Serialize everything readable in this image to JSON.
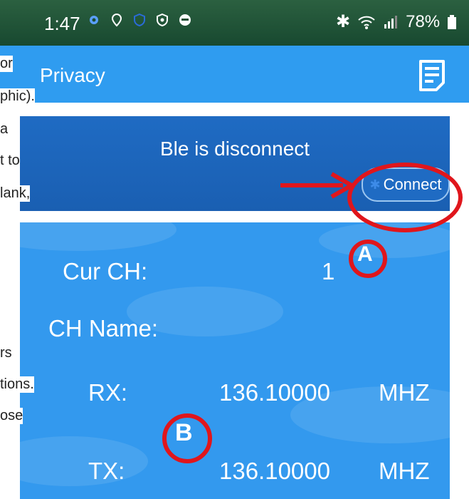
{
  "status_bar": {
    "time": "1:47",
    "battery": "78%",
    "icons_left": [
      "settings-icon",
      "location-icon",
      "shield-icon",
      "secure-icon",
      "vpn-icon"
    ],
    "icons_right": [
      "bluetooth-icon",
      "wifi-icon",
      "signal-icon",
      "battery-icon"
    ]
  },
  "app_bar": {
    "title": "Privacy",
    "menu_icon": "document-icon"
  },
  "banner": {
    "message": "Ble is disconnect",
    "connect_label": "Connect"
  },
  "channel": {
    "cur_ch_label": "Cur CH:",
    "cur_ch_value": "1",
    "ch_name_label": "CH Name:",
    "rx_label": "RX:",
    "rx_value": "136.10000",
    "rx_unit": "MHZ",
    "tx_label": "TX:",
    "tx_value": "136.10000",
    "tx_unit": "MHZ"
  },
  "annotations": {
    "marker_a": "A",
    "marker_b": "B"
  },
  "left_edge_text": [
    "or",
    "phic).",
    "a",
    "t to",
    "lank,",
    "rs",
    "tions.",
    "ose"
  ],
  "colors": {
    "status_bar": "#1d4f34",
    "app_bar": "#2f9cf0",
    "banner": "#1f6bc3",
    "panel": "#3399ee",
    "annotation": "#e0161c"
  }
}
